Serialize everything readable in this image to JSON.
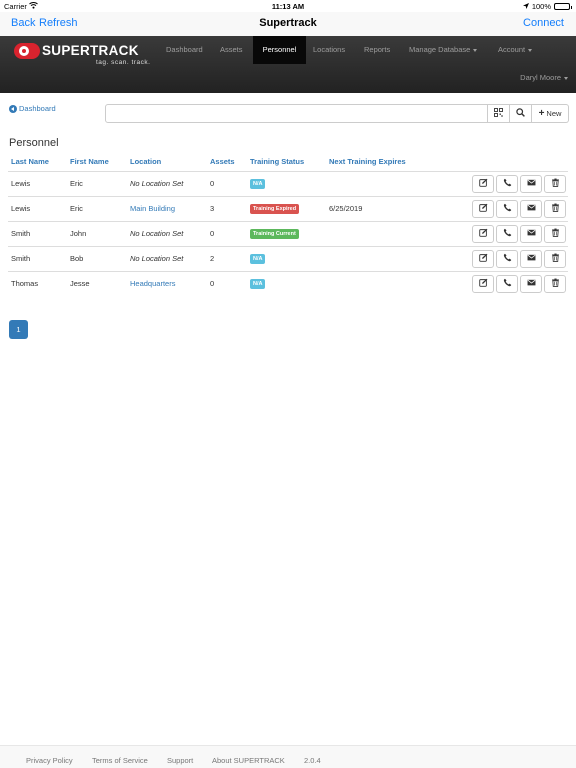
{
  "status_bar": {
    "carrier": "Carrier",
    "time": "11:13 AM",
    "battery": "100%",
    "battery_level": 1.0
  },
  "app_nav": {
    "back": "Back",
    "refresh": "Refresh",
    "title": "Supertrack",
    "connect": "Connect"
  },
  "brand": {
    "name": "SUPERTRACK",
    "tagline": "tag.  scan.  track."
  },
  "nav": {
    "items": [
      "Dashboard",
      "Assets",
      "Personnel",
      "Locations",
      "Reports",
      "Manage Database",
      "Account"
    ],
    "active": "Personnel",
    "user": "Daryl Moore"
  },
  "toolbar": {
    "dashboard_link": "Dashboard",
    "search_value": "",
    "new_label": "New"
  },
  "page": {
    "heading": "Personnel"
  },
  "table": {
    "headers": [
      "Last Name",
      "First Name",
      "Location",
      "Assets",
      "Training Status",
      "Next Training Expires"
    ],
    "rows": [
      {
        "last": "Lewis",
        "first": "Eric",
        "location": "No Location Set",
        "location_set": false,
        "assets": "0",
        "status": "N/A",
        "status_kind": "info",
        "expires": ""
      },
      {
        "last": "Lewis",
        "first": "Eric",
        "location": "Main Building",
        "location_set": true,
        "assets": "3",
        "status": "Training Expired",
        "status_kind": "danger",
        "expires": "6/25/2019"
      },
      {
        "last": "Smith",
        "first": "John",
        "location": "No Location Set",
        "location_set": false,
        "assets": "0",
        "status": "Training Current",
        "status_kind": "success",
        "expires": ""
      },
      {
        "last": "Smith",
        "first": "Bob",
        "location": "No Location Set",
        "location_set": false,
        "assets": "2",
        "status": "N/A",
        "status_kind": "info",
        "expires": ""
      },
      {
        "last": "Thomas",
        "first": "Jesse",
        "location": "Headquarters",
        "location_set": true,
        "assets": "0",
        "status": "N/A",
        "status_kind": "info",
        "expires": ""
      }
    ]
  },
  "pagination": {
    "current": "1"
  },
  "footer": {
    "links": [
      "Privacy Policy",
      "Terms of Service",
      "Support",
      "About SUPERTRACK"
    ],
    "version": "2.0.4"
  },
  "colors": {
    "ios_blue": "#147efb",
    "link": "#337ab7",
    "navbar": "#222222",
    "info": "#5bc0de",
    "danger": "#d9534f",
    "success": "#5cb85c"
  }
}
